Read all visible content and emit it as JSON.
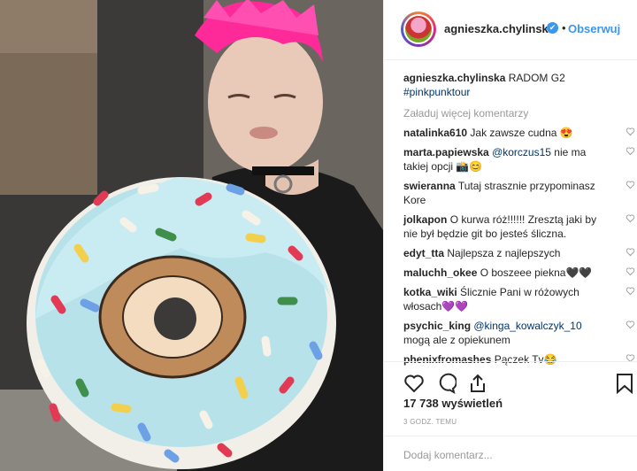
{
  "header": {
    "username": "agnieszka.chylinska",
    "verified_glyph": "✔",
    "follow_label": "Obserwuj"
  },
  "caption": {
    "username": "agnieszka.chylinska",
    "text": "RADOM G2",
    "hashtag": "#pinkpunktour"
  },
  "load_more": "Załaduj więcej komentarzy",
  "comments": [
    {
      "user": "natalinka610",
      "text": "Jak zawsze cudna 😍"
    },
    {
      "user": "marta.papiewska",
      "mention": "@korczus15",
      "text": "nie ma takiej opcji 📸😊"
    },
    {
      "user": "swieranna",
      "text": "Tutaj strasznie przypominasz Kore"
    },
    {
      "user": "jolkapon",
      "text": "O kurwa róż!!!!!! Zresztą jaki by nie był będzie git bo jesteś śliczna."
    },
    {
      "user": "edyt_tta",
      "text": "Najlepsza z najlepszych"
    },
    {
      "user": "maluchh_okee",
      "text": "O boszeee piekna🖤🖤"
    },
    {
      "user": "kotka_wiki",
      "text": "Ślicznie Pani w różowych włosach💜💜"
    },
    {
      "user": "psychic_king",
      "mention": "@kinga_kowalczyk_10",
      "text": "mogą ale z opiekunem"
    },
    {
      "user": "phenixfromashes",
      "text": "Pączek Tv😂"
    }
  ],
  "views": "17 738 wyświetleń",
  "time": "3 GODZ. TEMU",
  "add_comment_placeholder": "Dodaj komentarz..."
}
